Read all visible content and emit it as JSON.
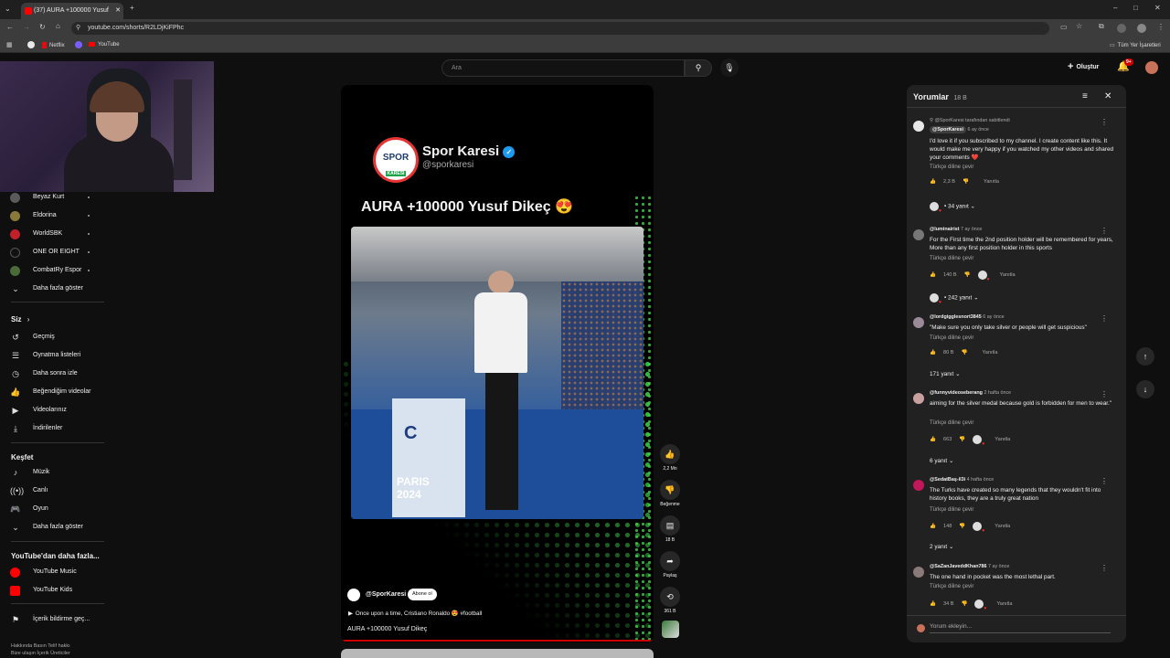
{
  "browser": {
    "tab_title": "(37) AURA +100000 Yusuf",
    "url": "youtube.com/shorts/R2LDjKiFPhc",
    "bookmarks": [
      "Netflix",
      "YouTube"
    ],
    "all_bookmarks": "Tüm Yer İşaretleri"
  },
  "sidebar": {
    "subscriptions": [
      {
        "label": "Beyaz Kurt",
        "color": "#5a5a5a"
      },
      {
        "label": "Eldorina",
        "color": "#8a7a3a"
      },
      {
        "label": "WorldSBK",
        "color": "#c0202a"
      },
      {
        "label": "ONE OR EIGHT",
        "color": "#111111"
      },
      {
        "label": "CombatRy Espor",
        "color": "#4a6a3a"
      }
    ],
    "show_more": "Daha fazla göster",
    "you_title": "Siz",
    "you_items": [
      "Geçmiş",
      "Oynatma listeleri",
      "Daha sonra izle",
      "Beğendiğim videolar",
      "Videolarınız",
      "İndirilenler"
    ],
    "explore_title": "Keşfet",
    "explore_items": [
      "Müzik",
      "Canlı",
      "Oyun"
    ],
    "explore_more": "Daha fazla göster",
    "more_title": "YouTube'dan daha fazla...",
    "more_items": [
      "YouTube Music",
      "YouTube Kids"
    ],
    "report": "İçerik bildirme geç...",
    "footer1": "Hakkında  Basın  Telif hakkı",
    "footer2": "Bize ulaşın  İçerik Üreticiler"
  },
  "topbar": {
    "search_placeholder": "Ara",
    "create": "Oluştur",
    "notif_badge": "9+"
  },
  "short": {
    "post_name": "Spor Karesi",
    "post_handle": "@sporkaresi",
    "post_title": "AURA +100000 Yusuf Dikeç 😍",
    "logo_text": "SPOR",
    "logo_sub": "KARESİ",
    "channel": "@SporKaresi",
    "subscribe": "Abone ol",
    "music": "Once upon a time, Cristiano Ronaldo 😍 #football",
    "caption": "AURA +100000 Yusuf Dikeç",
    "likes": "2,2 Mn",
    "dislike": "Beğenme",
    "comments": "18 B",
    "share": "Paylaş",
    "remix": "361 B"
  },
  "comments_panel": {
    "title": "Yorumlar",
    "count": "18 B",
    "add_placeholder": "Yorum ekleyin...",
    "pinned_by": "@SporKaresi tarafından sabitlendi",
    "translate": "Türkçe diline çevir",
    "reply": "Yanıtla",
    "items": [
      {
        "author": "@SporKaresi",
        "time": "6 ay önce",
        "text": "I'd love it if you subscribed to my channel. I create content like this. It would make me very happy if you watched my other videos and shared your comments ❤️",
        "likes": "2,3 B",
        "replies": "• 34 yanıt",
        "av": "#e8e8e8"
      },
      {
        "author": "@luminairist",
        "time": "7 ay önce",
        "text": "For the First time the 2nd position holder will be remembered for years,  More than any first position holder in this sports",
        "likes": "140 B",
        "replies": "• 242 yanıt",
        "av": "#777777"
      },
      {
        "author": "@lordgigglesnort3845",
        "time": "6 ay önce",
        "text": "\"Make sure you only take silver or people will get suspicious\"",
        "likes": "80 B",
        "replies": "171 yanıt",
        "av": "#9a8a9a"
      },
      {
        "author": "@funnyvideoseberang",
        "time": "2 hafta önce",
        "text": "aiming for the silver medal because gold is forbidden for men to wear.\"",
        "likes": "663",
        "replies": "6 yanıt",
        "av": "#c8a0a0"
      },
      {
        "author": "@SedatBaş-il3i",
        "time": "4 hafta önce",
        "text": "The Turks have created so many legends that they wouldn't fit into history books, they are a truly great nation",
        "likes": "148",
        "replies": "2 yanıt",
        "av": "#c2185b"
      },
      {
        "author": "@SaZanJaveddKhan786",
        "time": "7 ay önce",
        "text": "The one hand in pocket was the most lethal part.",
        "likes": "34 B",
        "replies": "",
        "av": "#8a7a7a"
      }
    ]
  }
}
